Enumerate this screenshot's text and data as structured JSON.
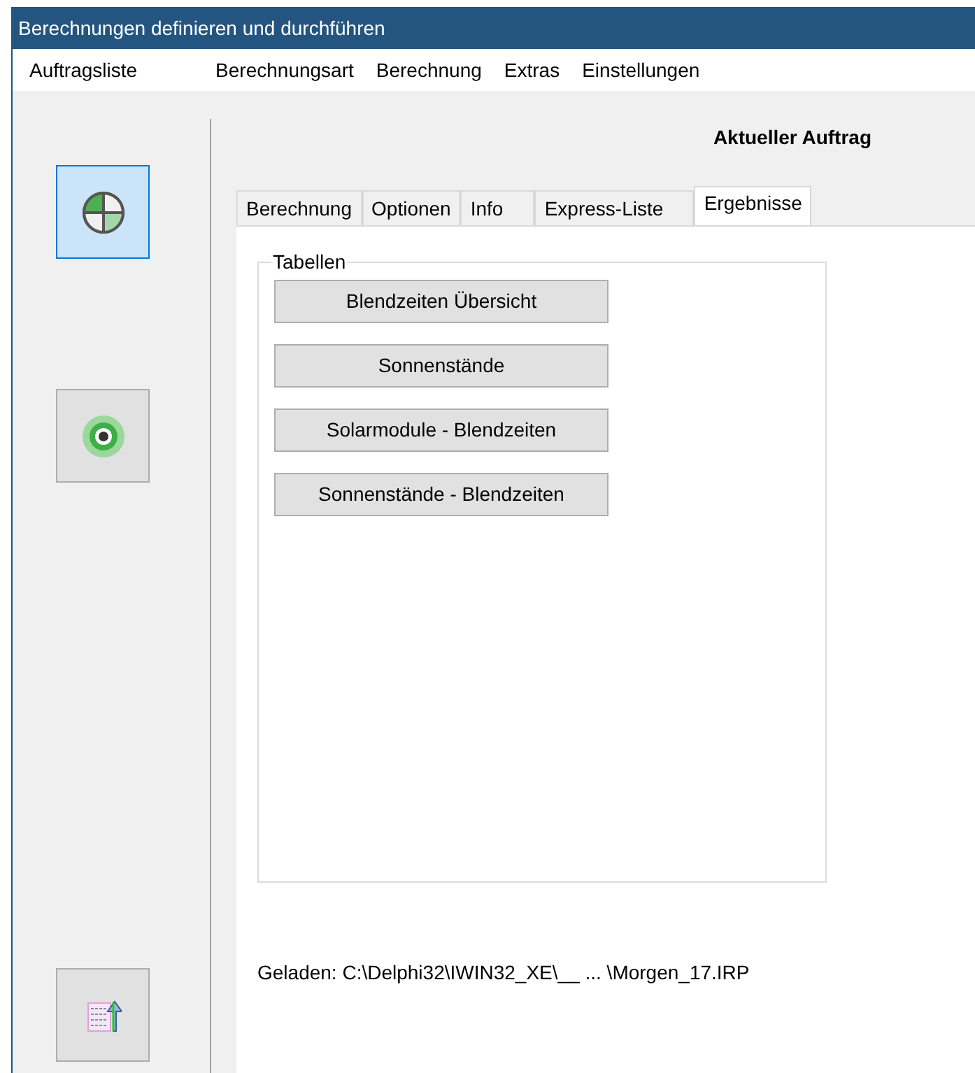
{
  "window": {
    "title": "Berechnungen definieren und durchführen"
  },
  "menu": [
    {
      "label": "Auftragsliste"
    },
    {
      "label": "Berechnungsart"
    },
    {
      "label": "Berechnung"
    },
    {
      "label": "Extras"
    },
    {
      "label": "Einstellungen"
    }
  ],
  "sidebar": {
    "items": [
      {
        "kind": "pie",
        "selected": true
      },
      {
        "kind": "target",
        "selected": false
      },
      {
        "kind": "list-upload",
        "selected": false
      }
    ]
  },
  "heading": "Aktueller Auftrag",
  "tabs": [
    {
      "label": "Berechnung",
      "selected": false
    },
    {
      "label": "Optionen",
      "selected": false
    },
    {
      "label": "Info",
      "selected": false
    },
    {
      "label": "Express-Liste",
      "selected": false
    },
    {
      "label": "Ergebnisse",
      "selected": true
    }
  ],
  "group": {
    "title": "Tabellen",
    "buttons": [
      "Blendzeiten Übersicht",
      "Sonnenstände",
      "Solarmodule - Blendzeiten",
      "Sonnenstände - Blendzeiten"
    ]
  },
  "status": "Geladen: C:\\Delphi32\\IWIN32_XE\\__ ... \\Morgen_17.IRP"
}
